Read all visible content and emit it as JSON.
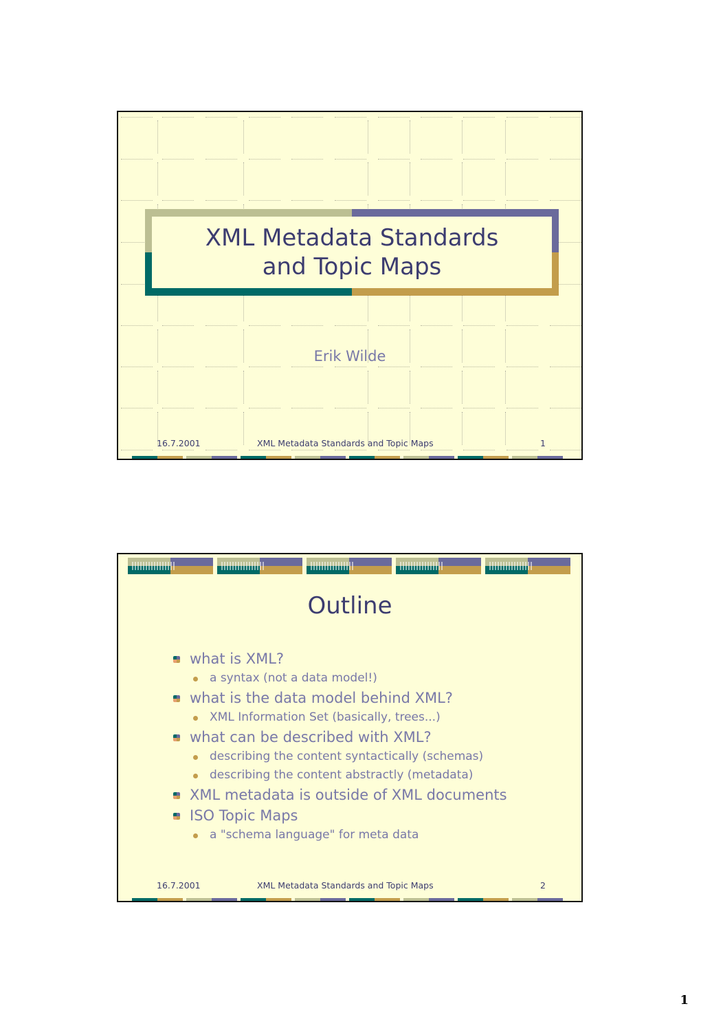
{
  "colors": {
    "slide_bg": "#fefed8",
    "title_text": "#3c3c70",
    "body_text": "#7878a8",
    "olive": "#bcbf93",
    "purple": "#6a6a9c",
    "teal": "#006a66",
    "gold": "#c39d4c"
  },
  "slides": [
    {
      "title_line1": "XML Metadata Standards",
      "title_line2": "and Topic Maps",
      "author": "Erik Wilde",
      "footer": {
        "date": "16.7.2001",
        "title": "XML Metadata Standards and Topic Maps",
        "number": "1"
      }
    },
    {
      "heading": "Outline",
      "items": [
        {
          "level": 1,
          "text": "what is XML?",
          "icon": "cube-bullet-icon"
        },
        {
          "level": 2,
          "text": "a syntax (not a data model!)",
          "icon": "dot-bullet-icon"
        },
        {
          "level": 1,
          "text": "what is the data model behind XML?",
          "icon": "cube-bullet-icon"
        },
        {
          "level": 2,
          "text": "XML Information Set (basically, trees...)",
          "icon": "dot-bullet-icon"
        },
        {
          "level": 1,
          "text": "what can be described with XML?",
          "icon": "cube-bullet-icon"
        },
        {
          "level": 2,
          "text": "describing the content syntactically (schemas)",
          "icon": "dot-bullet-icon"
        },
        {
          "level": 2,
          "text": "describing the content abstractly (metadata)",
          "icon": "dot-bullet-icon"
        },
        {
          "level": 1,
          "text": "XML metadata is outside of XML documents",
          "icon": "cube-bullet-icon"
        },
        {
          "level": 1,
          "text": "ISO Topic Maps",
          "icon": "cube-bullet-icon"
        },
        {
          "level": 2,
          "text": "a \"schema language\" for meta data",
          "icon": "dot-bullet-icon"
        }
      ],
      "footer": {
        "date": "16.7.2001",
        "title": "XML Metadata Standards and Topic Maps",
        "number": "2"
      }
    }
  ],
  "page_number": "1"
}
